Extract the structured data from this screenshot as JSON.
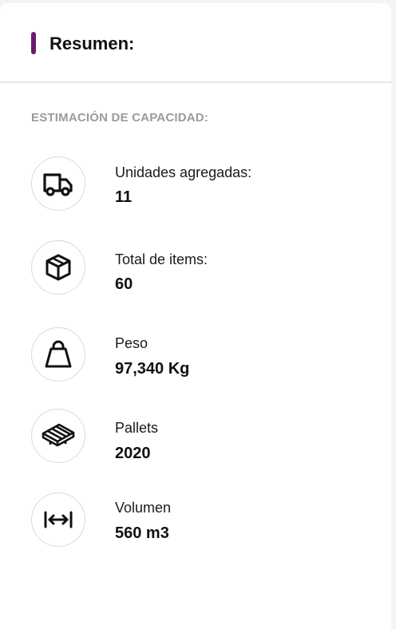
{
  "summary": {
    "title": "Resumen:",
    "accent_color": "#6a1b6e",
    "section_label": "ESTIMACIÓN DE CAPACIDAD:",
    "items": [
      {
        "icon": "truck-icon",
        "label": "Unidades agregadas:",
        "value": "11"
      },
      {
        "icon": "box-icon",
        "label": "Total de items:",
        "value": "60"
      },
      {
        "icon": "weight-icon",
        "label": "Peso",
        "value": "97,340 Kg"
      },
      {
        "icon": "pallet-icon",
        "label": "Pallets",
        "value": "2020"
      },
      {
        "icon": "volume-icon",
        "label": "Volumen",
        "value": "560 m3"
      }
    ]
  }
}
